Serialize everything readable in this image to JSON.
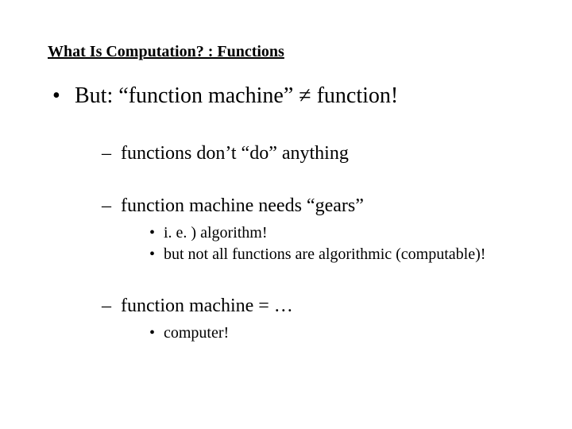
{
  "title": "What Is Computation? :  Functions",
  "bullet1": "But:  “function machine” ≠ function!",
  "sub1": "functions don’t “do” anything",
  "sub2": "function machine needs “gears”",
  "sub2a": "i. e. )  algorithm!",
  "sub2b": "but not all functions are algorithmic (computable)!",
  "sub3": "function machine = …",
  "sub3a": "computer!"
}
